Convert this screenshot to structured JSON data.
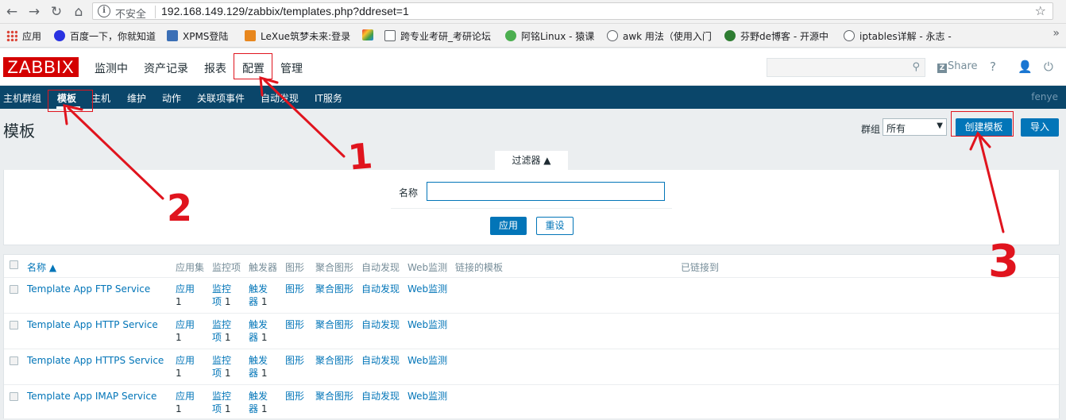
{
  "browser": {
    "insecure_label": "不安全",
    "url": "192.168.149.129/zabbix/templates.php?ddreset=1",
    "bookmarks": [
      {
        "label": "应用",
        "icon": "apps-grid-icon",
        "color": "#db4437"
      },
      {
        "label": "百度一下，你就知道",
        "icon": "baidu-paw-icon",
        "color": "#2932e1"
      },
      {
        "label": "XPMS登陆",
        "icon": "xpms-icon",
        "color": "#3b6fb6"
      },
      {
        "label": "LeXue筑梦未来:登录",
        "icon": "lexue-icon",
        "color": "#e8871e"
      },
      {
        "label": "",
        "icon": "colorful-icon",
        "color": "#9c27b0"
      },
      {
        "label": "跨专业考研_考研论坛",
        "icon": "document-icon",
        "color": "#ffffff"
      },
      {
        "label": "阿铭Linux - 猿课",
        "icon": "apelearn-icon",
        "color": "#4caf50"
      },
      {
        "label": "awk 用法（使用入门",
        "icon": "blog-icon",
        "color": "#ffffff"
      },
      {
        "label": "芬野de博客 - 开源中",
        "icon": "oschina-icon",
        "color": "#2e7d32"
      },
      {
        "label": "iptables详解 - 永志 -",
        "icon": "blog-icon",
        "color": "#ffffff"
      }
    ]
  },
  "header": {
    "logo": "ZABBIX",
    "menu": [
      "监测中",
      "资产记录",
      "报表",
      "配置",
      "管理"
    ],
    "share_label": "Share"
  },
  "subnav": {
    "items": [
      "主机群组",
      "模板",
      "主机",
      "维护",
      "动作",
      "关联项事件",
      "自动发现",
      "IT服务"
    ],
    "user": "fenye"
  },
  "page": {
    "title": "模板",
    "group_label": "群组",
    "group_value": "所有",
    "create_button": "创建模板",
    "import_button": "导入"
  },
  "filter": {
    "tab_label": "过滤器 ▲",
    "name_label": "名称",
    "name_value": "",
    "apply_button": "应用",
    "reset_button": "重设"
  },
  "table": {
    "headers": [
      "名称 ▲",
      "应用集",
      "监控项",
      "触发器",
      "图形",
      "聚合图形",
      "自动发现",
      "Web监测",
      "链接的模板",
      "已链接到"
    ],
    "rows": [
      {
        "name": "Template App FTP Service",
        "apps": "应用",
        "apps_count": "1",
        "items": "监控项",
        "items_count": "1",
        "triggers": "触发器",
        "triggers_count": "1",
        "graphs": "图形",
        "screens": "聚合图形",
        "discovery": "自动发现",
        "web": "Web监测"
      },
      {
        "name": "Template App HTTP Service",
        "apps": "应用",
        "apps_count": "1",
        "items": "监控项",
        "items_count": "1",
        "triggers": "触发器",
        "triggers_count": "1",
        "graphs": "图形",
        "screens": "聚合图形",
        "discovery": "自动发现",
        "web": "Web监测"
      },
      {
        "name": "Template App HTTPS Service",
        "apps": "应用",
        "apps_count": "1",
        "items": "监控项",
        "items_count": "1",
        "triggers": "触发器",
        "triggers_count": "1",
        "graphs": "图形",
        "screens": "聚合图形",
        "discovery": "自动发现",
        "web": "Web监测"
      },
      {
        "name": "Template App IMAP Service",
        "apps": "应用",
        "apps_count": "1",
        "items": "监控项",
        "items_count": "1",
        "triggers": "触发器",
        "triggers_count": "1",
        "graphs": "图形",
        "screens": "聚合图形",
        "discovery": "自动发现",
        "web": "Web监测"
      }
    ]
  },
  "annotations": {
    "labels": [
      "1",
      "2",
      "3"
    ],
    "color": "#e0141e"
  }
}
